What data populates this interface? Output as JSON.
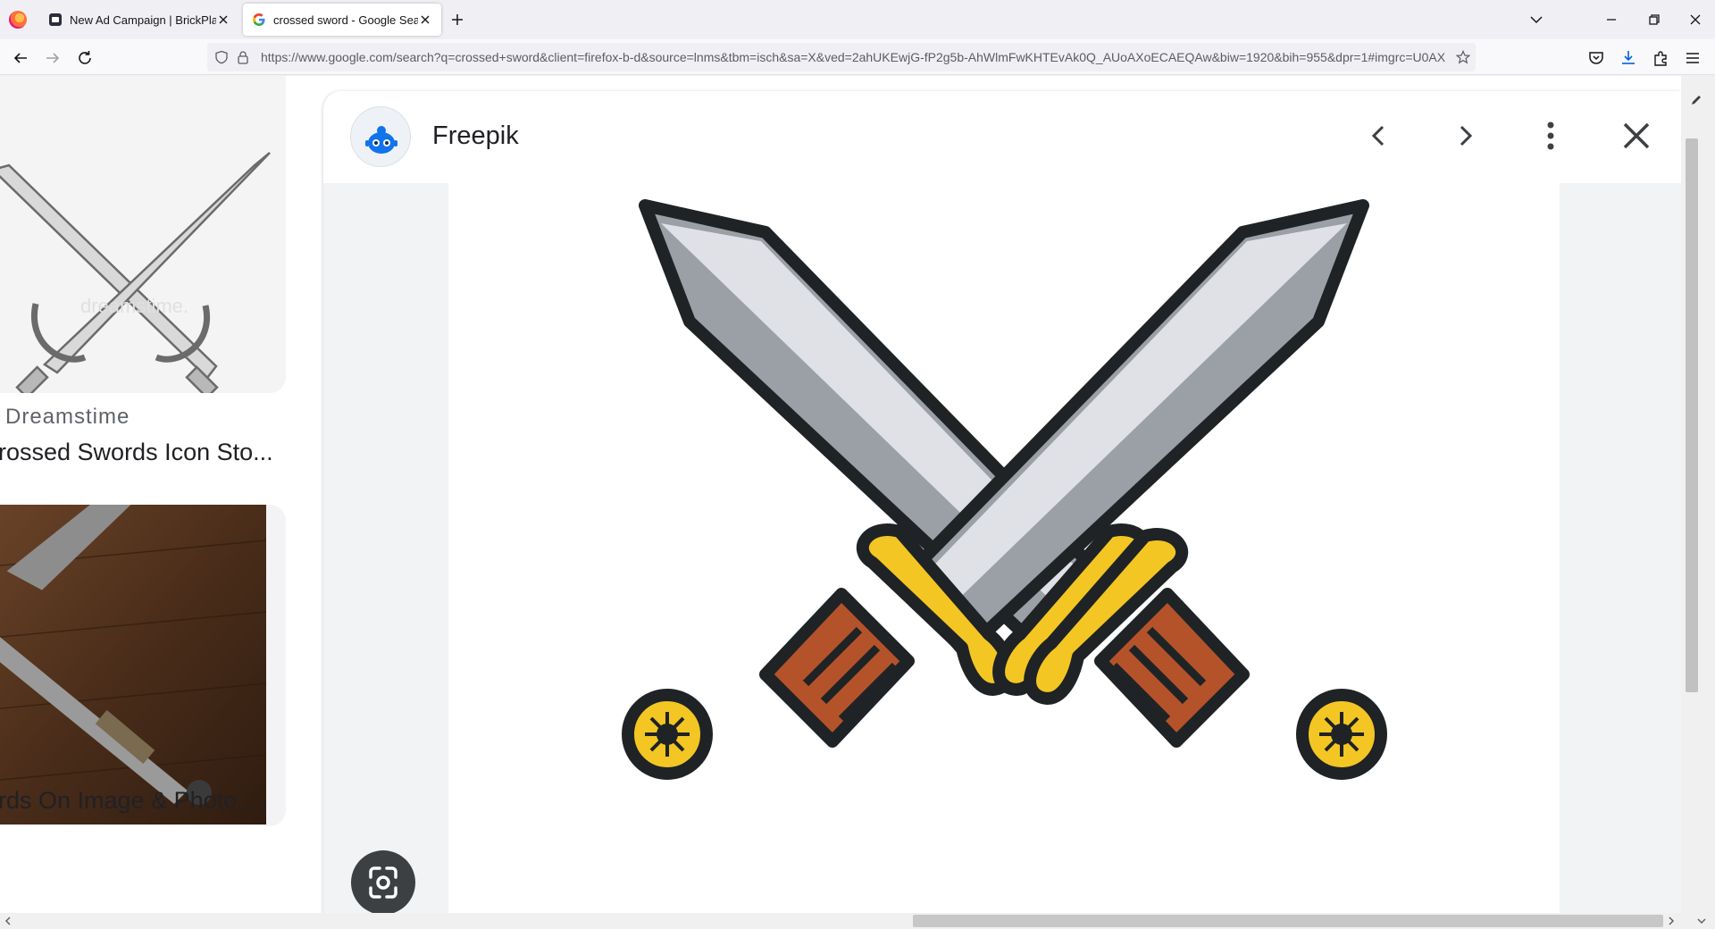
{
  "browser": {
    "tabs": [
      {
        "title": "New Ad Campaign | BrickPlanet",
        "active": false
      },
      {
        "title": "crossed sword - Google Search",
        "active": true
      }
    ],
    "url": "https://www.google.com/search?q=crossed+sword&client=firefox-b-d&source=lnms&tbm=isch&sa=X&ved=2ahUKEwjG-fP2g5b-AhWlmFwKHTEvAk0Q_AUoAXoECAEQAw&biw=1920&bih=955&dpr=1#imgrc=U0AX",
    "accent_color": "#0060df"
  },
  "results": [
    {
      "source": "Dreamstime",
      "caption": "rossed Swords Icon Sto..."
    },
    {
      "source": "",
      "caption": "rds On Image & Photo ..."
    }
  ],
  "preview": {
    "site_name": "Freepik"
  },
  "icons": {
    "prev": "chevron-left-icon",
    "next": "chevron-right-icon",
    "more": "more-vert-icon",
    "close": "close-icon",
    "lens": "google-lens-icon"
  },
  "colors": {
    "sword_yellow": "#f3c623",
    "sword_grip": "#b4532a",
    "blade_light": "#dfe1e6",
    "blade_dark": "#9aa0a6",
    "outline": "#1f2326"
  }
}
